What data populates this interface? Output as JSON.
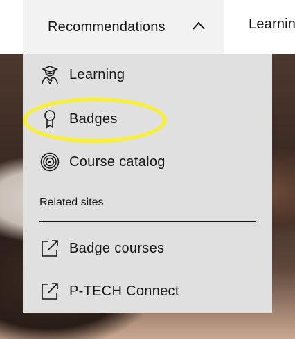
{
  "header": {
    "recommendations_label": "Recommendations",
    "next_nav_label": "Learnin"
  },
  "menu": {
    "items": [
      {
        "label": "Learning",
        "icon": "learner-icon"
      },
      {
        "label": "Badges",
        "icon": "badge-icon"
      },
      {
        "label": "Course catalog",
        "icon": "target-icon"
      }
    ],
    "related_label": "Related sites",
    "related_items": [
      {
        "label": "Badge courses",
        "icon": "external-link-icon"
      },
      {
        "label": "P-TECH Connect",
        "icon": "external-link-icon"
      }
    ]
  },
  "colors": {
    "menu_bg": "#e0e0e0",
    "trigger_bg": "#f2f2f2",
    "text": "#161616",
    "highlight": "#f7ef3b"
  }
}
